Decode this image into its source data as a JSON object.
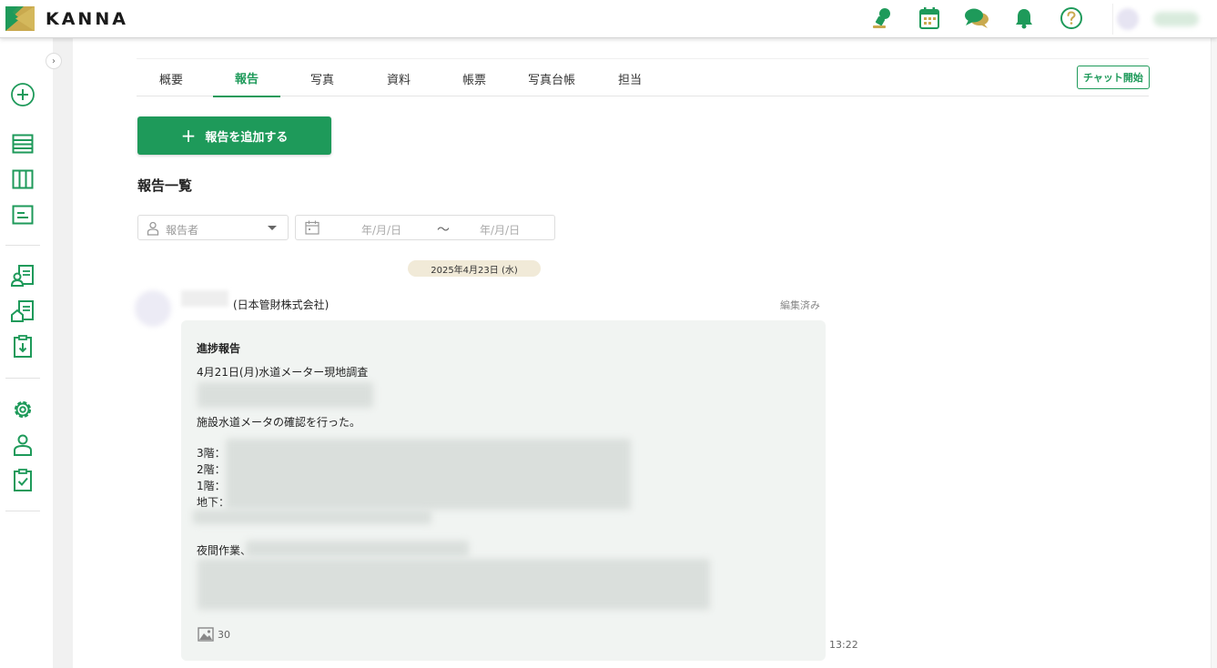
{
  "app": {
    "brand": "KANNA"
  },
  "tabs": [
    {
      "label": "概要"
    },
    {
      "label": "報告"
    },
    {
      "label": "写真"
    },
    {
      "label": "資料"
    },
    {
      "label": "帳票"
    },
    {
      "label": "写真台帳"
    },
    {
      "label": "担当"
    }
  ],
  "active_tab": "報告",
  "chat_button": "チャット開始",
  "add_report_button": "報告を追加する",
  "list_title": "報告一覧",
  "filters": {
    "reporter_placeholder": "報告者",
    "date_from_placeholder": "年/月/日",
    "date_separator": "〜",
    "date_to_placeholder": "年/月/日"
  },
  "date_divider": "2025年4月23日 (水)",
  "post": {
    "author_org": "(日本管財株式会社)",
    "edited_label": "編集済み",
    "title": "進捗報告",
    "line1": "4月21日(月)水道メーター現地調査",
    "line2": "施設水道メータの確認を行った。",
    "floor3": "3階：",
    "floor2": "2階：",
    "floor1": "1階：",
    "basement": "地下：",
    "night_work": "夜間作業、",
    "photo_count": "30",
    "time": "13:22"
  },
  "colors": {
    "accent": "#1e9a5a",
    "date_pill": "#f1ead8",
    "card_bg": "#f1f4f2"
  }
}
